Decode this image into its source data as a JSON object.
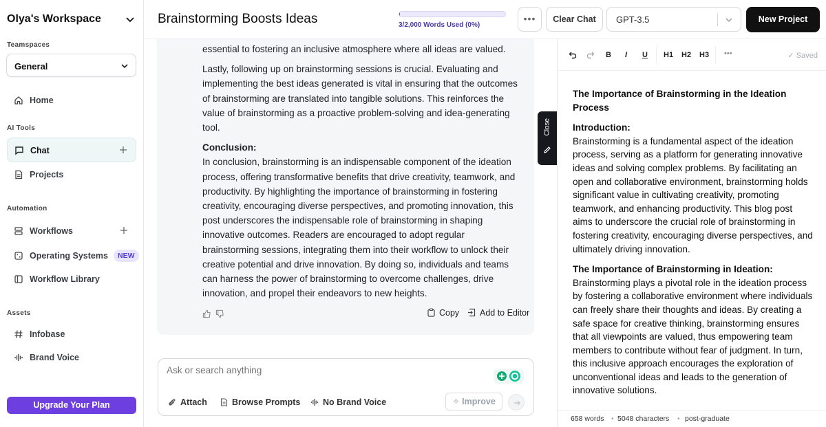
{
  "sidebar": {
    "workspace_title": "Olya's Workspace",
    "teamspaces_label": "Teamspaces",
    "teamspace_value": "General",
    "home_label": "Home",
    "ai_tools_label": "AI Tools",
    "chat_label": "Chat",
    "projects_label": "Projects",
    "automation_label": "Automation",
    "workflows_label": "Workflows",
    "operating_systems_label": "Operating Systems",
    "new_badge": "NEW",
    "workflow_library_label": "Workflow Library",
    "assets_label": "Assets",
    "infobase_label": "Infobase",
    "brand_voice_label": "Brand Voice",
    "upgrade_label": "Upgrade Your Plan"
  },
  "header": {
    "title": "Brainstorming Boosts Ideas",
    "usage_text": "3/2,000 Words Used (0%)",
    "usage_fraction": 0.0015,
    "more_label": "•••",
    "clear_chat_label": "Clear Chat",
    "model_value": "GPT-3.5",
    "new_project_label": "New Project"
  },
  "chat": {
    "para1": "essential to fostering an inclusive atmosphere where all ideas are valued.",
    "para2": "Lastly, following up on brainstorming sessions is crucial. Evaluating and implementing the best ideas generated is vital in ensuring that the outcomes of brainstorming are translated into tangible solutions. This reinforces the value of brainstorming as a proactive problem-solving and idea-generating tool.",
    "conclusion_heading": "Conclusion:",
    "conclusion_text": "In conclusion, brainstorming is an indispensable component of the ideation process, offering transformative benefits that drive creativity, teamwork, and productivity. By highlighting the importance of brainstorming in fostering creativity, encouraging diverse perspectives, and promoting innovation, this post underscores the indispensable role of brainstorming in shaping innovative outcomes. Readers are encouraged to adopt regular brainstorming sessions, integrating them into their workflow to unlock their creative potential and drive innovation. By doing so, individuals and teams can harness the power of brainstorming to overcome challenges, drive innovation, and propel their endeavors to new heights.",
    "copy_label": "Copy",
    "add_to_editor_label": "Add to Editor",
    "input_placeholder": "Ask or search anything",
    "attach_label": "Attach",
    "browse_prompts_label": "Browse Prompts",
    "brand_voice_label": "No Brand Voice",
    "improve_label": "Improve",
    "close_tab_label": "Close"
  },
  "editor": {
    "toolbar": {
      "bold": "B",
      "italic": "I",
      "underline": "U",
      "h1": "H1",
      "h2": "H2",
      "h3": "H3",
      "more": "•••",
      "saved": "Saved"
    },
    "doc_title": "The Importance of Brainstorming in the Ideation Process",
    "intro_heading": "Introduction:",
    "intro_text": "Brainstorming is a fundamental aspect of the ideation process, serving as a platform for generating innovative ideas and solving complex problems. By facilitating an open and collaborative environment, brainstorming holds significant value in cultivating creativity, promoting teamwork, and enhancing productivity. This blog post aims to underscore the crucial role of brainstorming in fostering creativity, encouraging diverse perspectives, and ultimately driving innovation.",
    "section2_heading": "The Importance of Brainstorming in Ideation:",
    "section2_text": "Brainstorming plays a pivotal role in the ideation process by fostering a collaborative environment where individuals can freely share their thoughts and ideas. By creating a safe space for creative thinking, brainstorming ensures that all viewpoints are valued, thus empowering team members to contribute without fear of judgment. In turn, this inclusive approach encourages the exploration of unconventional ideas and leads to the generation of innovative solutions.",
    "status": {
      "words": "658 words",
      "characters": "5048 characters",
      "level": "post-graduate"
    }
  },
  "colors": {
    "accent": "#6d3ee0",
    "dark": "#111111",
    "active_nav": "#eef6f6"
  }
}
